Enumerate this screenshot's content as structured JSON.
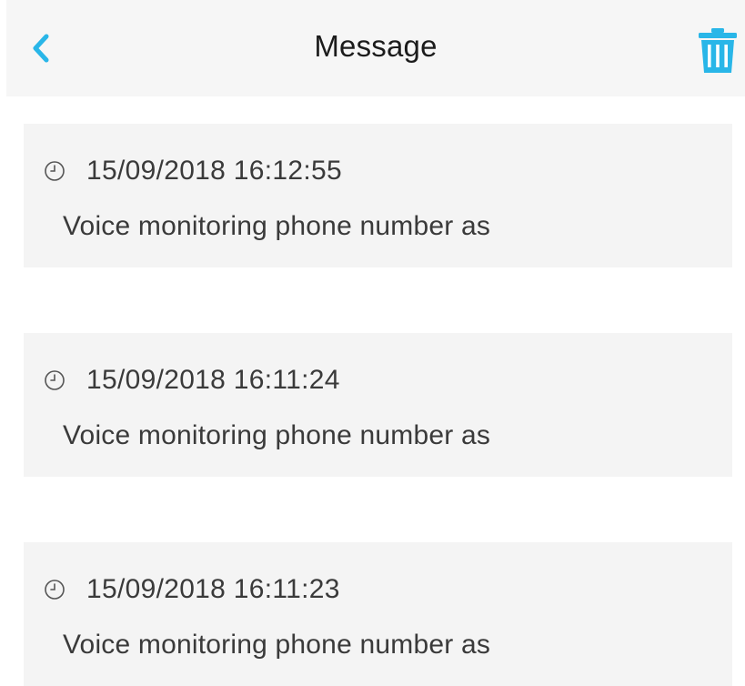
{
  "header": {
    "title": "Message",
    "accent_color": "#29b6e8"
  },
  "messages": [
    {
      "timestamp": "15/09/2018 16:12:55",
      "text": "Voice monitoring phone number as"
    },
    {
      "timestamp": "15/09/2018 16:11:24",
      "text": "Voice monitoring phone number as"
    },
    {
      "timestamp": "15/09/2018 16:11:23",
      "text": "Voice monitoring phone number as"
    }
  ],
  "icons": {
    "back": "chevron-left-icon",
    "delete": "trash-icon",
    "time": "clock-icon"
  }
}
